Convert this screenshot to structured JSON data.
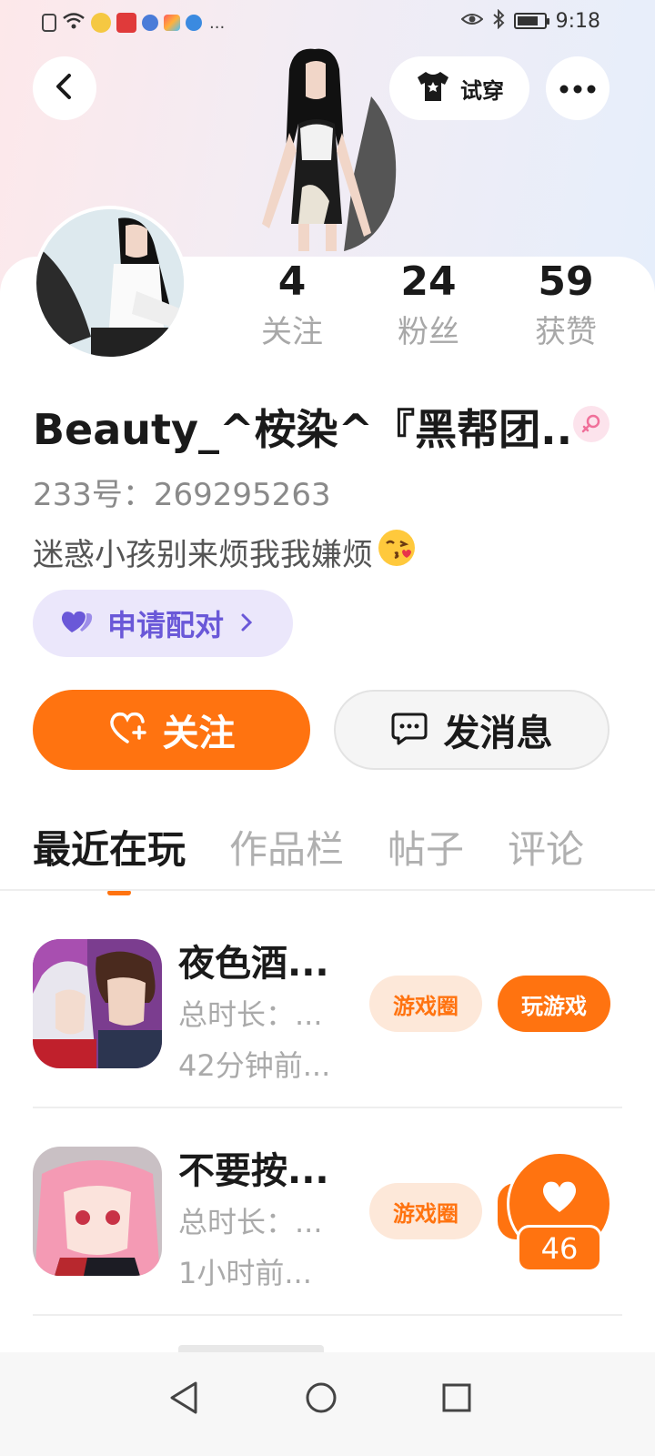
{
  "status_bar": {
    "time": "9:18",
    "more_indicator": "..."
  },
  "header": {
    "back_icon": "chevron-left-icon",
    "try_on_label": "试穿",
    "more_icon": "more-horizontal-icon"
  },
  "profile": {
    "stats": [
      {
        "value": "4",
        "label": "关注"
      },
      {
        "value": "24",
        "label": "粉丝"
      },
      {
        "value": "59",
        "label": "获赞"
      }
    ],
    "username": "Beauty_^桉染^『黑帮团...",
    "gender": "female",
    "user_id": "233号：269295263",
    "bio": "迷惑小孩别来烦我我嫌烦",
    "bio_emoji": "kissing-face-icon",
    "pair_button": "申请配对"
  },
  "actions": {
    "follow_label": "关注",
    "message_label": "发消息"
  },
  "tabs": [
    "最近在玩",
    "作品栏",
    "帖子",
    "评论"
  ],
  "active_tab": 0,
  "games": [
    {
      "name": "夜色酒...",
      "duration": "总时长：...",
      "last_played": "42分钟前...",
      "circle_label": "游戏圈",
      "play_label": "玩游戏"
    },
    {
      "name": "不要按...",
      "duration": "总时长：...",
      "last_played": "1小时前...",
      "circle_label": "游戏圈",
      "play_label": ""
    }
  ],
  "like_float": {
    "count": "46"
  },
  "colors": {
    "accent": "#ff7310",
    "pair_bg": "#ebe7fb",
    "pair_text": "#6a58d8",
    "muted_text": "#aaaaaa"
  }
}
